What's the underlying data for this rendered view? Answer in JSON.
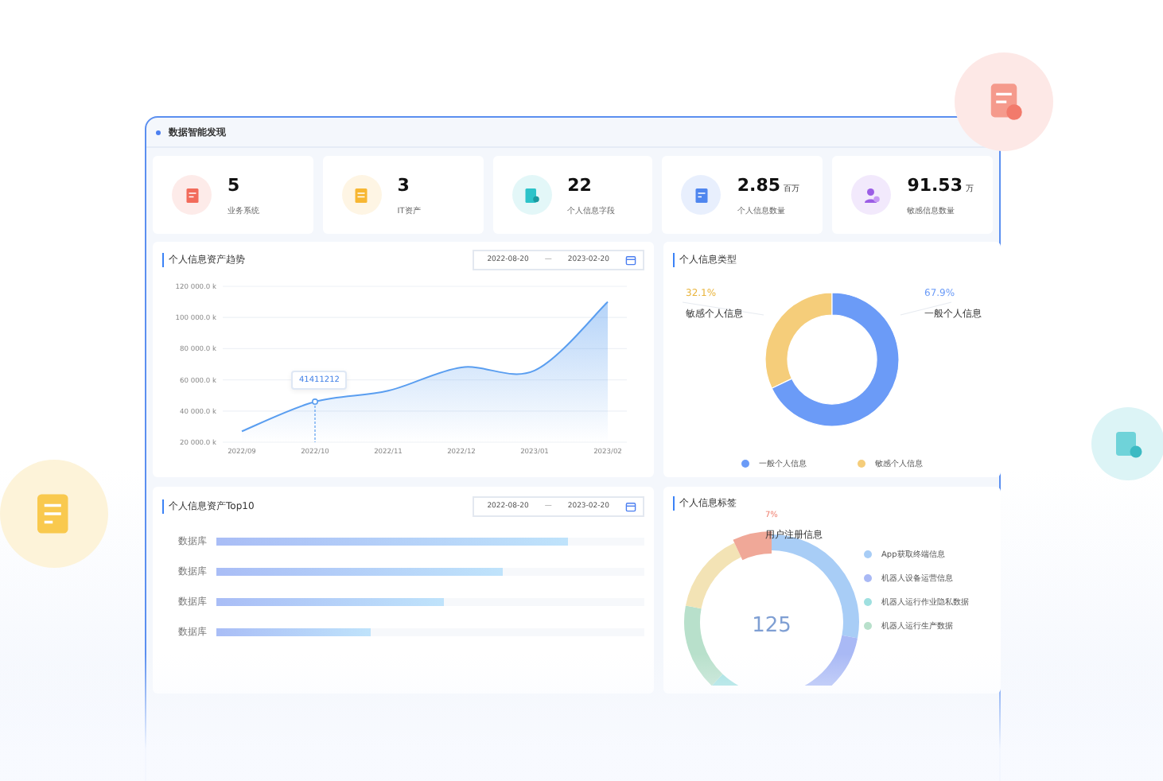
{
  "window": {
    "title": "数据智能发现"
  },
  "stats": [
    {
      "value": "5",
      "label": "业务系统",
      "kind": "doc",
      "color": "#f26b5b"
    },
    {
      "value": "3",
      "label": "IT资产",
      "kind": "note",
      "color": "#f7b733"
    },
    {
      "value": "22",
      "label": "个人信息字段",
      "kind": "file",
      "color": "#2cc3c9"
    },
    {
      "value": "2.85",
      "unit": "百万",
      "label": "个人信息数量",
      "kind": "edit",
      "color": "#4f86ef"
    },
    {
      "value": "91.53",
      "unit": "万",
      "label": "敏感信息数量",
      "kind": "user",
      "color": "#9b5de5"
    }
  ],
  "trend": {
    "title": "个人信息资产趋势",
    "date_from": "2022-08-20",
    "separator": "—",
    "date_to": "2023-02-20",
    "tooltip": "41411212",
    "chart_data": {
      "type": "area",
      "categories": [
        "2022/09",
        "2022/10",
        "2022/11",
        "2022/12",
        "2023/01",
        "2023/02"
      ],
      "grid": true,
      "series": [
        {
          "color": "#5a9ef0",
          "values": [
            27000,
            46000,
            53000,
            68000,
            66000,
            110000
          ]
        }
      ],
      "ylim": [
        20000,
        120000
      ],
      "yticks": [
        {
          "value": 20000,
          "label": "20 000.0 k"
        },
        {
          "value": 40000,
          "label": "40 000.0 k"
        },
        {
          "value": 60000,
          "label": "60 000.0 k"
        },
        {
          "value": 80000,
          "label": "80 000.0 k"
        },
        {
          "value": 100000,
          "label": "100 000.0 k"
        },
        {
          "value": 120000,
          "label": "120 000.0 k"
        }
      ]
    }
  },
  "types": {
    "title": "个人信息类型",
    "chart_data": {
      "type": "donut",
      "categories": [
        "敏感个人信息",
        "一般个人信息"
      ],
      "values": [
        32.1,
        67.9
      ],
      "colors": [
        "#f5cd7a",
        "#6b9bf7"
      ]
    },
    "callouts": [
      {
        "value": "32.1%"
      },
      {
        "value": "67.9%"
      }
    ],
    "legend": [
      "一般个人信息",
      "敏感个人信息"
    ]
  },
  "top10": {
    "title": "个人信息资产Top10",
    "date_from": "2022-08-20",
    "separator": "—",
    "date_to": "2023-02-20",
    "rows": [
      {
        "label": "数据库",
        "level": 0.82
      },
      {
        "label": "数据库",
        "level": 0.67
      },
      {
        "label": "数据库",
        "level": 0.53
      },
      {
        "label": "数据库",
        "level": 0.36
      }
    ]
  },
  "labels": {
    "title": "个人信息标签",
    "total": "125",
    "callout_value": "7%",
    "callout_label": "用户注册信息",
    "legend": [
      {
        "label": "App获取终端信息",
        "color": "#a8cdf6"
      },
      {
        "label": "机器人设备运营信息",
        "color": "#a9b9f5"
      },
      {
        "label": "机器人运行作业隐私数据",
        "color": "#9fe0e0"
      },
      {
        "label": "机器人运行生产数据",
        "color": "#b8e0cb"
      }
    ]
  }
}
